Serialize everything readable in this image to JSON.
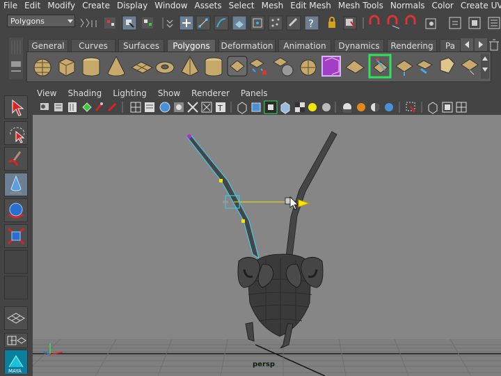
{
  "menu": [
    "File",
    "Edit",
    "Modify",
    "Create",
    "Display",
    "Window",
    "Assets",
    "Select",
    "Mesh",
    "Edit Mesh",
    "Mesh Tools",
    "Normals",
    "Color",
    "Create UVs"
  ],
  "status_line": {
    "mode": "Polygons"
  },
  "shelf": {
    "tabs": [
      "General",
      "Curves",
      "Surfaces",
      "Polygons",
      "Deformation",
      "Animation",
      "Dynamics",
      "Rendering",
      "Pa"
    ],
    "active_tab": "Polygons"
  },
  "panel_menu": [
    "View",
    "Shading",
    "Lighting",
    "Show",
    "Renderer",
    "Panels"
  ],
  "viewport": {
    "camera_label": "persp"
  },
  "colors": {
    "accent_cyan": "#41c6e6",
    "selection_yellow": "#f0e800",
    "manip_yellow": "#ffe600"
  }
}
